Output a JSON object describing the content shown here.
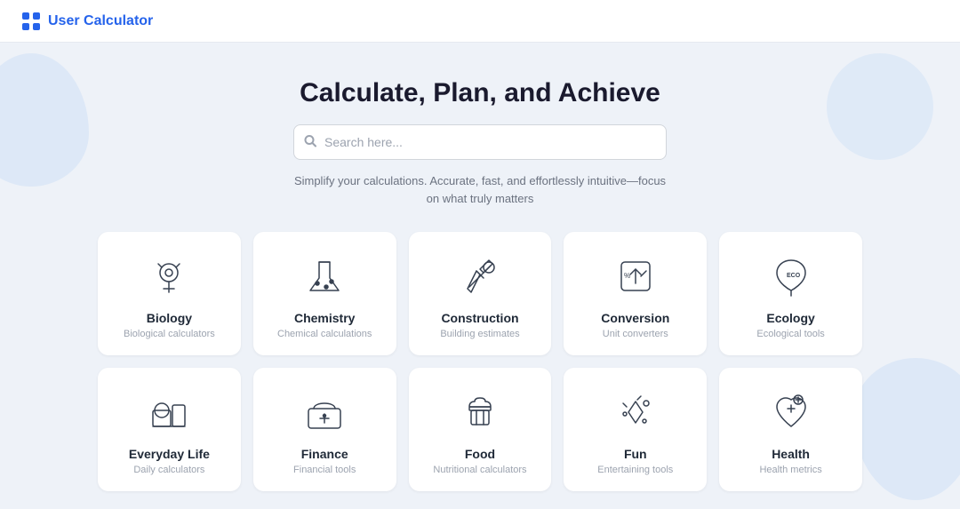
{
  "header": {
    "logo_text": "User Calculator",
    "logo_icon": "grid-icon"
  },
  "hero": {
    "title": "Calculate, Plan, and Achieve",
    "search_placeholder": "Search here...",
    "subtitle": "Simplify your calculations. Accurate, fast, and effortlessly intuitive—focus on what truly matters"
  },
  "cards": [
    {
      "id": "biology",
      "title": "Biology",
      "subtitle": "Biological calculators",
      "icon": "biology-icon"
    },
    {
      "id": "chemistry",
      "title": "Chemistry",
      "subtitle": "Chemical calculations",
      "icon": "chemistry-icon"
    },
    {
      "id": "construction",
      "title": "Construction",
      "subtitle": "Building estimates",
      "icon": "construction-icon"
    },
    {
      "id": "conversion",
      "title": "Conversion",
      "subtitle": "Unit converters",
      "icon": "conversion-icon"
    },
    {
      "id": "ecology",
      "title": "Ecology",
      "subtitle": "Ecological tools",
      "icon": "ecology-icon"
    },
    {
      "id": "everyday-life",
      "title": "Everyday Life",
      "subtitle": "Daily calculators",
      "icon": "everyday-icon"
    },
    {
      "id": "finance",
      "title": "Finance",
      "subtitle": "Financial tools",
      "icon": "finance-icon"
    },
    {
      "id": "food",
      "title": "Food",
      "subtitle": "Nutritional calculators",
      "icon": "food-icon"
    },
    {
      "id": "fun",
      "title": "Fun",
      "subtitle": "Entertaining tools",
      "icon": "fun-icon"
    },
    {
      "id": "health",
      "title": "Health",
      "subtitle": "Health metrics",
      "icon": "health-icon"
    }
  ]
}
